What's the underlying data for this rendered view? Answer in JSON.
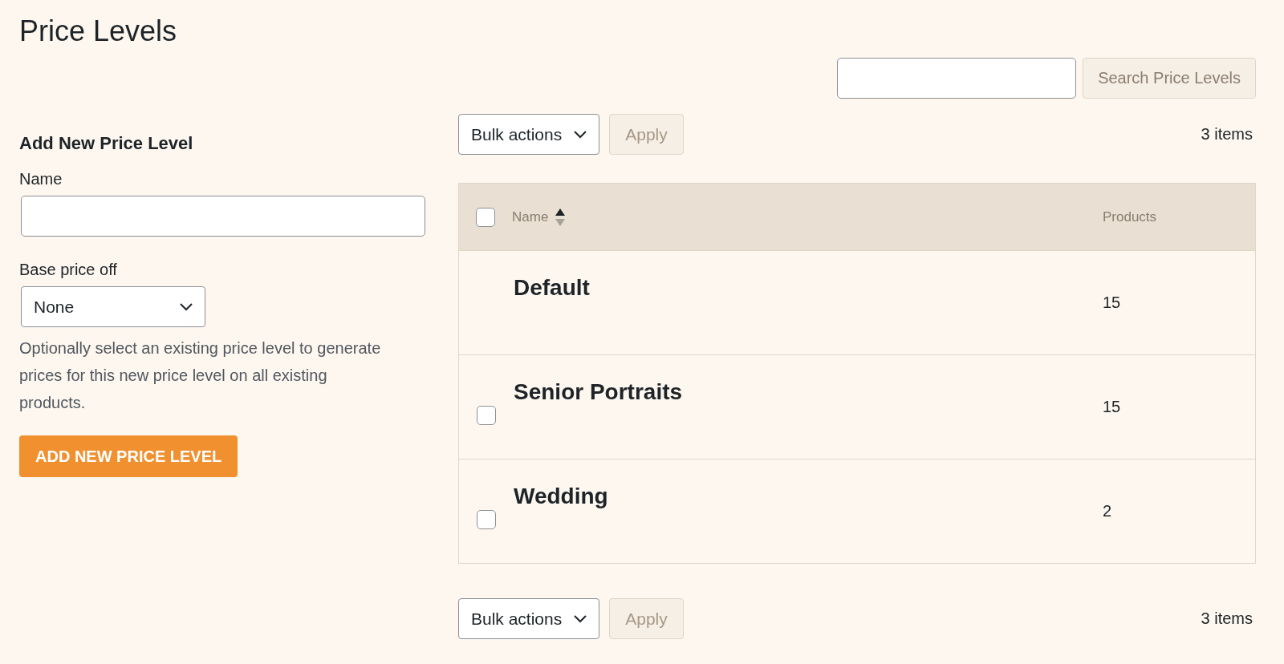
{
  "title": "Price Levels",
  "add_form": {
    "heading": "Add New Price Level",
    "name_label": "Name",
    "base_price_label": "Base price off",
    "base_price_value": "None",
    "help": "Optionally select an existing price level to generate prices for this new price level on all existing products.",
    "submit": "ADD NEW PRICE LEVEL"
  },
  "search": {
    "button": "Search Price Levels"
  },
  "top_nav": {
    "bulk_action": "Bulk actions",
    "apply": "Apply",
    "count": "3 items"
  },
  "table": {
    "select_all": {
      "checked": false
    },
    "columns": [
      {
        "label": "Name",
        "sorted_ascending": true
      },
      {
        "label": "Products"
      }
    ],
    "rows": [
      {
        "name": "Default",
        "products": "15",
        "has_checkbox": false
      },
      {
        "name": "Senior Portraits",
        "products": "15",
        "has_checkbox": true,
        "checked": false
      },
      {
        "name": "Wedding",
        "products": "2",
        "has_checkbox": true,
        "checked": false
      }
    ]
  },
  "bottom_nav": {
    "bulk_action": "Bulk actions",
    "apply": "Apply",
    "count": "3 items"
  }
}
